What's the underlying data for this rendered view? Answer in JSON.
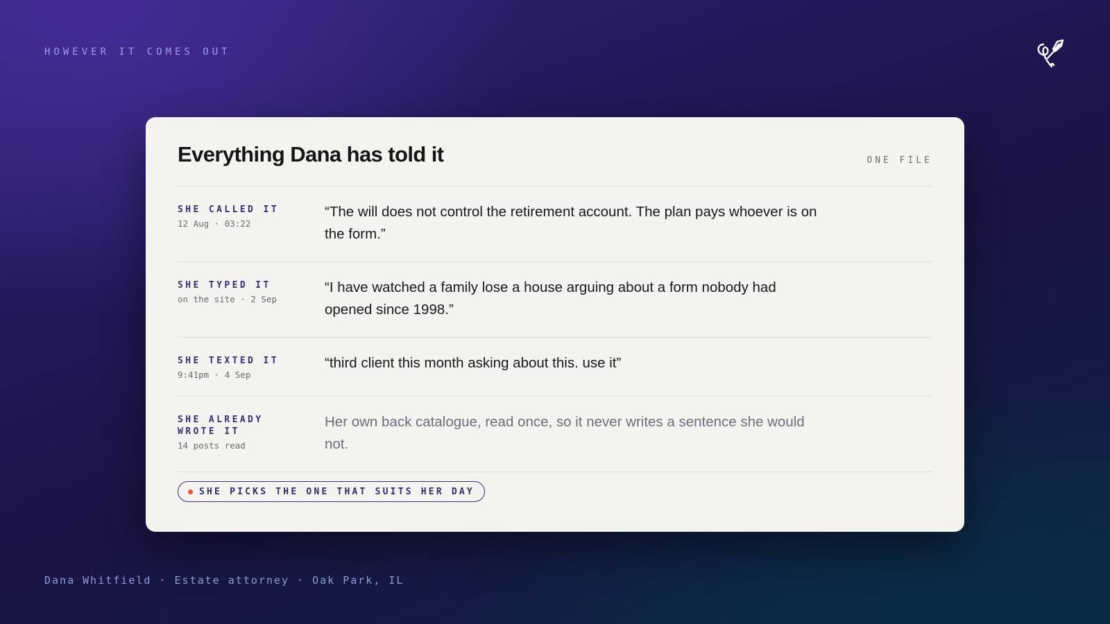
{
  "header": {
    "eyebrow": "HOWEVER IT COMES OUT",
    "logo_icon": "quill-pen-icon"
  },
  "card": {
    "title": "Everything Dana has told it",
    "tag": "ONE FILE",
    "rows": [
      {
        "label": "SHE CALLED IT",
        "sub": "12 Aug · 03:22",
        "quote": "“The will does not control the retirement account. The plan pays whoever is on the form.”"
      },
      {
        "label": "SHE TYPED IT",
        "sub": "on the site · 2 Sep",
        "quote": "“I have watched a family lose a house arguing about a form nobody had opened since 1998.”"
      },
      {
        "label": "SHE TEXTED IT",
        "sub": "9:41pm · 4 Sep",
        "quote": "“third client this month asking about this. use it”"
      },
      {
        "label": "SHE ALREADY WROTE IT",
        "sub": "14 posts read",
        "quote": "Her own back catalogue, read once, so it never writes a sentence she would not."
      }
    ],
    "pill": "SHE PICKS THE ONE THAT SUITS HER DAY"
  },
  "footer": {
    "text": "Dana Whitfield · Estate attorney · Oak Park, IL"
  },
  "colors": {
    "accent_dot": "#e8552a",
    "label_ink": "#33316e",
    "card_bg": "#f5f3ef"
  }
}
